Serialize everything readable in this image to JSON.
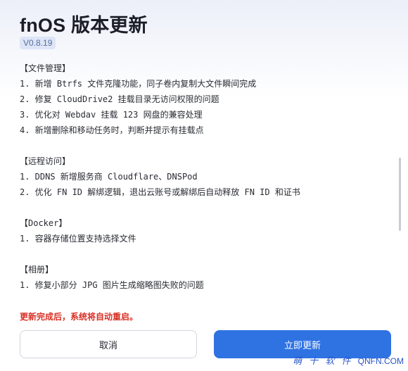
{
  "dialog": {
    "title": "fnOS 版本更新",
    "version": "V0.8.19",
    "sections": [
      {
        "title": "【文件管理】",
        "items": [
          "1. 新增 Btrfs 文件克隆功能，同子卷内复制大文件瞬间完成",
          "2. 修复 CloudDrive2 挂载目录无访问权限的问题",
          "3. 优化对 Webdav 挂载 123 网盘的兼容处理",
          "4. 新增删除和移动任务时，判断并提示有挂载点"
        ]
      },
      {
        "title": "【远程访问】",
        "items": [
          "1. DDNS 新增服务商 Cloudflare、DNSPod",
          "2. 优化 FN ID 解绑逻辑，退出云账号或解绑后自动释放 FN ID 和证书"
        ]
      },
      {
        "title": "【Docker】",
        "items": [
          "1. 容器存储位置支持选择文件"
        ]
      },
      {
        "title": "【相册】",
        "items": [
          "1. 修复小部分 JPG 图片生成缩略图失败的问题"
        ]
      }
    ],
    "warning": "更新完成后，系统将自动重启。",
    "cancel_label": "取消",
    "update_label": "立即更新"
  },
  "watermark": {
    "text": "萌 十 软 件",
    "url": "QNFN.COM"
  },
  "colors": {
    "primary": "#2f73e3",
    "warning": "#d93026",
    "version_badge_bg": "#dde5f7"
  }
}
